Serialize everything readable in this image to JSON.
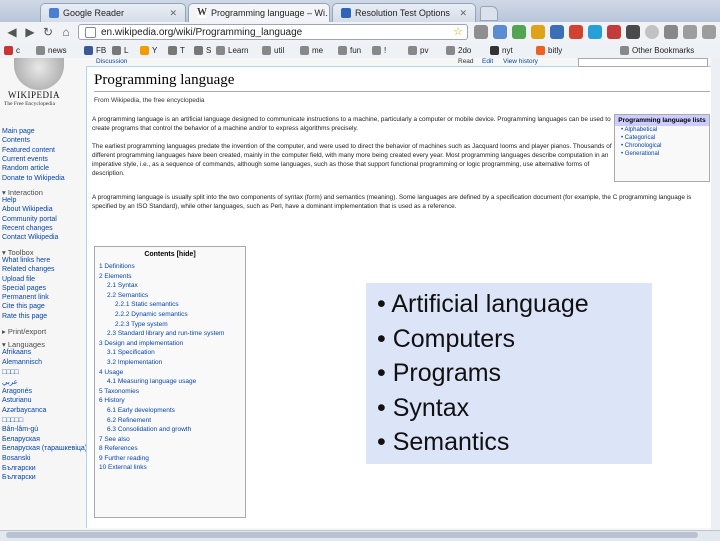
{
  "tabs": [
    {
      "label": "Google Reader",
      "color": "#4a7fd4"
    },
    {
      "label": "Programming language – Wi…",
      "color": "#333333"
    },
    {
      "label": "Resolution Test Options",
      "color": "#2f63b8"
    }
  ],
  "address_bar": {
    "url": "en.wikipedia.org/wiki/Programming_language"
  },
  "bookmarks": [
    {
      "label": "c",
      "color": "#cc3333"
    },
    {
      "label": "news",
      "color": "#888888"
    },
    {
      "label": "FB",
      "color": "#3b5998"
    },
    {
      "label": "L",
      "color": "#777777"
    },
    {
      "label": "Y",
      "color": "#f49b00"
    },
    {
      "label": "T",
      "color": "#777777"
    },
    {
      "label": "S",
      "color": "#777777"
    },
    {
      "label": "Learn",
      "color": "#888888"
    },
    {
      "label": "util",
      "color": "#888888"
    },
    {
      "label": "me",
      "color": "#888888"
    },
    {
      "label": "fun",
      "color": "#888888"
    },
    {
      "label": "!",
      "color": "#888888"
    },
    {
      "label": "pv",
      "color": "#888888"
    },
    {
      "label": "2do",
      "color": "#888888"
    },
    {
      "label": "nyt",
      "color": "#333333"
    },
    {
      "label": "bitly",
      "color": "#ee6123"
    },
    {
      "label": "Other Bookmarks",
      "color": "#888888"
    }
  ],
  "wiki": {
    "logo_name": "WIKIPEDIA",
    "logo_tagline": "The Free Encyclopedia",
    "tab_discussion": "Discussion",
    "tab_read": "Read",
    "tab_edit": "Edit",
    "tab_history": "View history",
    "article_title": "Programming language",
    "from_line": "From Wikipedia, the free encyclopedia",
    "intro_1": "A programming language is an artificial language designed to communicate instructions to a machine, particularly a computer or mobile device. Programming languages can be used to create programs that control the behavior of a machine and/or to express algorithms precisely.",
    "intro_2": "The earliest programming languages predate the invention of the computer, and were used to direct the behavior of machines such as Jacquard looms and player pianos. Thousands of different programming languages have been created, mainly in the computer field, with many more being created every year. Most programming languages describe computation in an imperative style, i.e., as a sequence of commands, although some languages, such as those that support functional programming or logic programming, use alternative forms of description.",
    "intro_3": "A programming language is usually split into the two components of syntax (form) and semantics (meaning). Some languages are defined by a specification document (for example, the C programming language is specified by an ISO Standard), while other languages, such as Perl, have a dominant implementation that is used as a reference."
  },
  "sidebar": {
    "nav": [
      "Main page",
      "Contents",
      "Featured content",
      "Current events",
      "Random article",
      "Donate to Wikipedia"
    ],
    "interaction_head": "▾ Interaction",
    "interaction": [
      "Help",
      "About Wikipedia",
      "Community portal",
      "Recent changes",
      "Contact Wikipedia"
    ],
    "toolbox_head": "▾ Toolbox",
    "toolbox": [
      "What links here",
      "Related changes",
      "Upload file",
      "Special pages",
      "Permanent link",
      "Cite this page",
      "Rate this page"
    ],
    "print_head": "▸ Print/export",
    "languages_head": "▾ Languages",
    "languages": [
      "Afrikaans",
      "Alemannisch",
      "□□□□",
      "عربي",
      "Aragonés",
      "Asturianu",
      "Azərbaycanca",
      "□□□□□",
      "Bân-lâm-gú",
      "Беларуская",
      "Беларуская (тарашкевіца)",
      "Bosanski",
      "Български",
      "Български"
    ]
  },
  "infobox": {
    "title": "Programming language lists",
    "items": [
      "Alphabetical",
      "Categorical",
      "Chronological",
      "Generational"
    ]
  },
  "toc": {
    "title": "Contents [hide]",
    "items": [
      "1 Definitions",
      "2 Elements",
      "2.1 Syntax",
      "2.2 Semantics",
      "2.2.1 Static semantics",
      "2.2.2 Dynamic semantics",
      "2.2.3 Type system",
      "2.3 Standard library and run-time system",
      "3 Design and implementation",
      "3.1 Specification",
      "3.2 Implementation",
      "4 Usage",
      "4.1 Measuring language usage",
      "5 Taxonomies",
      "6 History",
      "6.1 Early developments",
      "6.2 Refinement",
      "6.3 Consolidation and growth",
      "7 See also",
      "8 References",
      "9 Further reading",
      "10 External links"
    ]
  },
  "overlay": {
    "items": [
      "• Artificial language",
      "• Computers",
      "• Programs",
      "• Syntax",
      "• Semantics"
    ]
  }
}
